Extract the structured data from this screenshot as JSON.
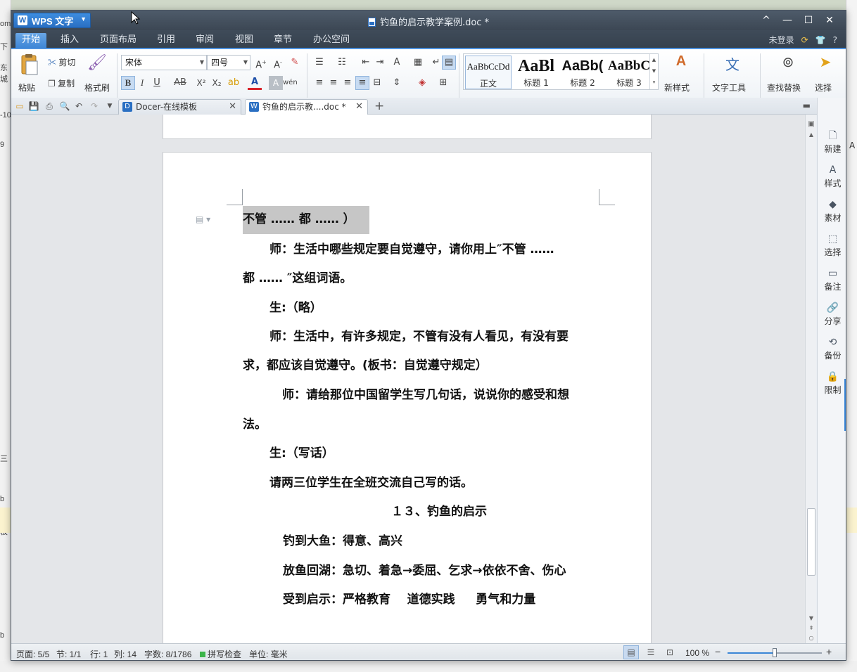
{
  "background": {
    "left_snippets": [
      "om",
      "东城",
      "下",
      "-10",
      "9",
      "三",
      "b",
      "模板",
      "b"
    ],
    "right_snippets": [
      "A"
    ]
  },
  "app": {
    "app_button": "WPS 文字",
    "window_title": "钓鱼的启示教学案例.doc *",
    "controls": [
      "^",
      "—",
      "☐",
      "✕"
    ]
  },
  "menu": {
    "tabs": [
      "开始",
      "插入",
      "页面布局",
      "引用",
      "审阅",
      "视图",
      "章节",
      "办公空间"
    ],
    "active": "开始",
    "login": "未登录",
    "help": "?"
  },
  "ribbon": {
    "paste": "粘贴",
    "cut": "剪切",
    "copy": "复制",
    "format_painter": "格式刷",
    "font_name": "宋体",
    "font_size": "四号",
    "bold": "B",
    "italic": "I",
    "underline": "U",
    "strikethrough": "AB",
    "superscript": "X²",
    "subscript": "X₂",
    "font_color": "A",
    "styles": [
      {
        "sample": "AaBbCcDd",
        "label": "正文"
      },
      {
        "sample": "AaBl",
        "label": "标题 1"
      },
      {
        "sample": "AaBb(",
        "label": "标题 2"
      },
      {
        "sample": "AaBbC",
        "label": "标题 3"
      }
    ],
    "new_style": "新样式",
    "text_tools": "文字工具",
    "find_replace": "查找替换",
    "select": "选择"
  },
  "doc_tabs": [
    {
      "label": "Docer-在线模板",
      "icon_color": "#2a6fc2"
    },
    {
      "label": "钓鱼的启示教....doc *",
      "icon_color": "#2a6fc2"
    }
  ],
  "document": {
    "selected_line": "不管 …… 都 …… ）",
    "lines": [
      "师：生活中哪些规定要自觉遵守，请你用上″不管 ……",
      "都 …… ″这组词语。",
      "生:（略）",
      "师：生活中，有许多规定，不管有没有人看见，有没有要",
      "求，都应该自觉遵守。(板书：自觉遵守规定）",
      "师：请给那位中国留学生写几句话，说说你的感受和想",
      "法。",
      "生:（写话）",
      "请两三位学生在全班交流自己写的话。",
      "１３、钓鱼的启示",
      "钓到大鱼：得意、高兴",
      "放鱼回湖：急切、着急→委屈、乞求→依依不舍、伤心",
      "受到启示：严格教育    道德实践     勇气和力量"
    ]
  },
  "taskpane": {
    "items": [
      "新建",
      "样式",
      "素材",
      "选择",
      "备注",
      "分享",
      "备份",
      "限制"
    ]
  },
  "status": {
    "page": "页面: 5/5",
    "section": "节: 1/1",
    "row": "行: 1",
    "col": "列: 14",
    "word_count": "字数: 8/1786",
    "spell_check": "拼写检查",
    "unit": "单位: 毫米",
    "zoom": "100 %",
    "zoom_level": 0.5
  }
}
